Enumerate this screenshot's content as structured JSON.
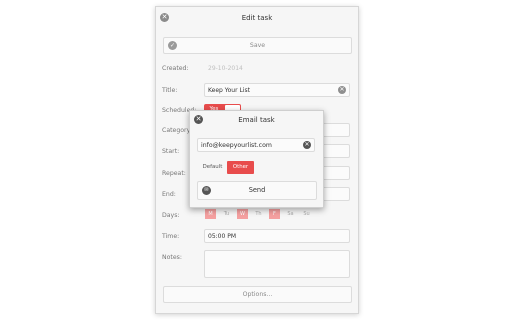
{
  "window": {
    "title": "Edit task",
    "close_icon": "close-icon",
    "save_label": "Save",
    "save_icon": "checkmark-icon"
  },
  "form": {
    "created_label": "Created:",
    "created_value": "29-10-2014",
    "title_label": "Title:",
    "title_value": "Keep Your List",
    "scheduled_label": "Scheduled:",
    "scheduled_toggle": "Yes",
    "category_label": "Category:",
    "start_label": "Start:",
    "repeat_label": "Repeat:",
    "end_label": "End:",
    "days_label": "Days:",
    "days": [
      {
        "label": "M",
        "selected": true
      },
      {
        "label": "Tu",
        "selected": false
      },
      {
        "label": "W",
        "selected": true
      },
      {
        "label": "Th",
        "selected": false
      },
      {
        "label": "F",
        "selected": true
      },
      {
        "label": "Sa",
        "selected": false
      },
      {
        "label": "Su",
        "selected": false
      }
    ],
    "time_label": "Time:",
    "time_value": "05:00 PM",
    "notes_label": "Notes:",
    "notes_value": "",
    "options_label": "Options..."
  },
  "email_dialog": {
    "title": "Email task",
    "close_icon": "close-icon",
    "email_value": "info@keepyourlist.com",
    "clear_icon": "clear-icon",
    "mode_options": [
      "Default",
      "Other"
    ],
    "selected_mode": "Other",
    "send_label": "Send",
    "send_icon": "envelope-icon"
  },
  "colors": {
    "accent": "#e84c4c",
    "day_selected": "#f5a0a0",
    "window_bg": "#f6f6f6"
  }
}
